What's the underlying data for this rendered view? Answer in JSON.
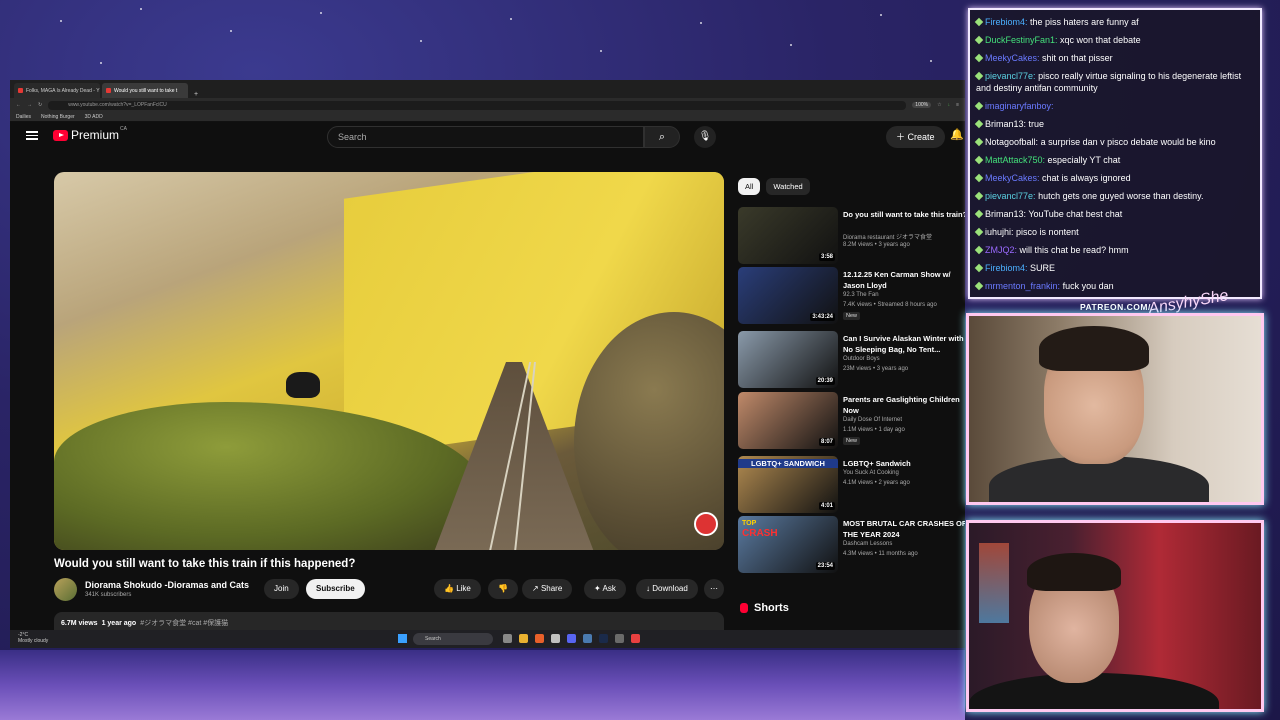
{
  "browser": {
    "tabs": [
      {
        "label": "Folks, MAGA Is Already Dead - Y"
      },
      {
        "label": "Would you still want to take t"
      }
    ],
    "url": "www.youtube.com/watch?v=_LOPFanFclCU",
    "zoom": "100%",
    "bookmarks": [
      "Dailies",
      "Nothing Burger",
      "3D ADD"
    ]
  },
  "youtube": {
    "logo_text": "Premium",
    "logo_region": "CA",
    "search_placeholder": "Search",
    "create_label": "Create",
    "video": {
      "title": "Would you still want to take this train if this happened?",
      "channel": "Diorama Shokudo -Dioramas and Cats",
      "subscribers": "341K subscribers",
      "join_label": "Join",
      "subscribe_label": "Subscribe",
      "like_label": "Like",
      "share_label": "Share",
      "ask_label": "Ask",
      "download_label": "Download",
      "views": "6.7M views",
      "age": "1 year ago",
      "tags": "#ジオラマ食堂 #cat #保護猫"
    },
    "chips": [
      "All",
      "Watched"
    ],
    "recommendations": [
      {
        "title": "Do you still want to take this train?",
        "channel": "Diorama restaurant ジオラマ食堂",
        "meta": "8.2M views • 3 years ago",
        "duration": "3:58",
        "new": "",
        "color": "#3a3a2a"
      },
      {
        "title": "12.12.25 Ken Carman Show w/ Jason Lloyd",
        "channel": "92.3 The Fan",
        "meta": "7.4K views • Streamed 8 hours ago",
        "duration": "3:43:24",
        "new": "New",
        "color": "#2a3e7a"
      },
      {
        "title": "Can I Survive Alaskan Winter with No Sleeping Bag, No Tent...",
        "channel": "Outdoor Boys",
        "meta": "23M views • 3 years ago",
        "duration": "20:39",
        "new": "",
        "color": "#8a9aaa"
      },
      {
        "title": "Parents are Gaslighting Children Now",
        "channel": "Daily Dose Of Internet",
        "meta": "1.1M views • 1 day ago",
        "duration": "8:07",
        "new": "New",
        "color": "#c08a6a"
      },
      {
        "title": "LGBTQ+ Sandwich",
        "channel": "You Suck At Cooking",
        "meta": "4.1M views • 2 years ago",
        "duration": "4:01",
        "new": "",
        "color": "#b08a50"
      },
      {
        "title": "MOST BRUTAL CAR CRASHES OF THE YEAR 2024",
        "channel": "Dashcam Lessons",
        "meta": "4.3M views • 11 months ago",
        "duration": "23:54",
        "new": "",
        "color": "#5a7aa0"
      }
    ],
    "thumb_captions": {
      "sandwich": "LGBTQ+ SANDWICH",
      "crash_top": "TOP",
      "crash_main": "CRASH"
    },
    "shorts_label": "Shorts"
  },
  "taskbar": {
    "weather_temp": "-2°C",
    "weather_desc": "Mostly cloudy",
    "search_label": "Search"
  },
  "chat": [
    {
      "name": "Firebiom4:",
      "text": "the piss haters are funny af",
      "color": "#4bb0ff"
    },
    {
      "name": "DuckFestinyFan1:",
      "text": "xqc won that debate",
      "color": "#44e07a"
    },
    {
      "name": "MeekyCakes:",
      "text": "shit on that pisser",
      "color": "#6a7aff"
    },
    {
      "name": "pievancl77e:",
      "text": "pisco really virtue signaling to his degenerate leftist and destiny antifan community",
      "color": "#5ad0e0"
    },
    {
      "name": "imaginaryfanboy:",
      "text": "",
      "color": "#6a7aff"
    },
    {
      "name": "Briman13:",
      "text": "true",
      "color": "#ffffff"
    },
    {
      "name": "Notagoofball:",
      "text": "a surprise dan v pisco debate would be kino",
      "color": "#ffffff"
    },
    {
      "name": "MattAttack750:",
      "text": "especially YT chat",
      "color": "#44e07a"
    },
    {
      "name": "MeekyCakes:",
      "text": "chat is always ignored",
      "color": "#6a7aff"
    },
    {
      "name": "pievancl77e:",
      "text": "hutch gets one guyed worse than destiny.",
      "color": "#5ad0e0"
    },
    {
      "name": "Briman13:",
      "text": "YouTube chat best chat",
      "color": "#ffffff"
    },
    {
      "name": "iuhujhi:",
      "text": "pisco is nontent",
      "color": "#ffffff"
    },
    {
      "name": "ZMJQ2:",
      "text": "will this chat be read? hmm",
      "color": "#9a6aff"
    },
    {
      "name": "Firebiom4:",
      "text": "SURE",
      "color": "#4bb0ff"
    },
    {
      "name": "mrmenton_frankin:",
      "text": "fuck you dan",
      "color": "#6a7aff"
    }
  ],
  "overlay": {
    "patreon": "PATREON.COM/",
    "signature": "AnsyhyShe"
  }
}
